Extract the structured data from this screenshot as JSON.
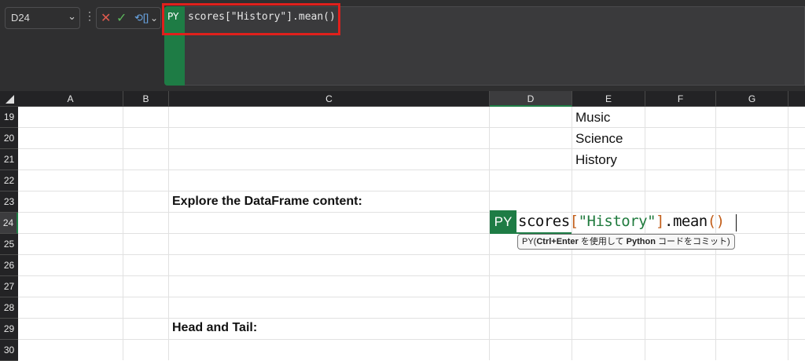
{
  "formula_bar": {
    "name_box": "D24",
    "more_glyph": "⋮",
    "cancel_glyph": "✕",
    "enter_glyph": "✓",
    "python_insert_glyph": "⟲[]",
    "chevron_glyph": "⌄",
    "mode_label": "PY",
    "formula": "scores[\"History\"].mean()"
  },
  "columns": [
    "A",
    "B",
    "C",
    "D",
    "E",
    "F",
    "G"
  ],
  "rows": [
    "19",
    "20",
    "21",
    "22",
    "23",
    "24",
    "25",
    "26",
    "27",
    "28",
    "29",
    "30"
  ],
  "cells": {
    "E19": "Music",
    "E20": "Science",
    "E21": "History",
    "C23": "Explore the DataFrame content:",
    "C29": "Head and Tail:"
  },
  "edit_cell": {
    "address": "D24",
    "mode_label": "PY",
    "code_name": "scores",
    "code_open": "[",
    "code_string": "\"History\"",
    "code_close": "]",
    "code_method": ".mean",
    "code_parens": "()"
  },
  "tooltip": {
    "prefix": "PY(",
    "bold_text": "Ctrl+Enter",
    "middle": " を使用して ",
    "bold_python": "Python",
    "suffix": " コードをコミット)"
  },
  "colors": {
    "python_green": "#1e7c45",
    "highlight_red": "#e0201c",
    "toolbar_bg": "#2f2f30"
  }
}
